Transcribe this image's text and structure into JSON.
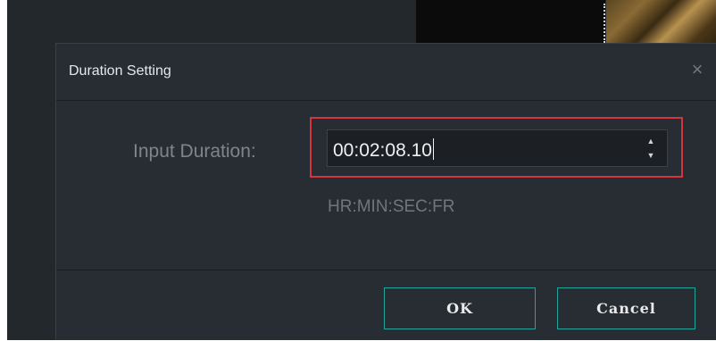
{
  "dialog": {
    "title": "Duration Setting",
    "close_icon": "×"
  },
  "duration": {
    "label": "Input Duration:",
    "value": "00:02:08.10",
    "format_hint": "HR:MIN:SEC:FR",
    "spin_up_glyph": "▲",
    "spin_down_glyph": "▼"
  },
  "buttons": {
    "ok_label": "OK",
    "cancel_label": "Cancel"
  },
  "colors": {
    "highlight": "#d5363d",
    "button_border": "#22a59b",
    "dialog_bg": "#282d33"
  }
}
